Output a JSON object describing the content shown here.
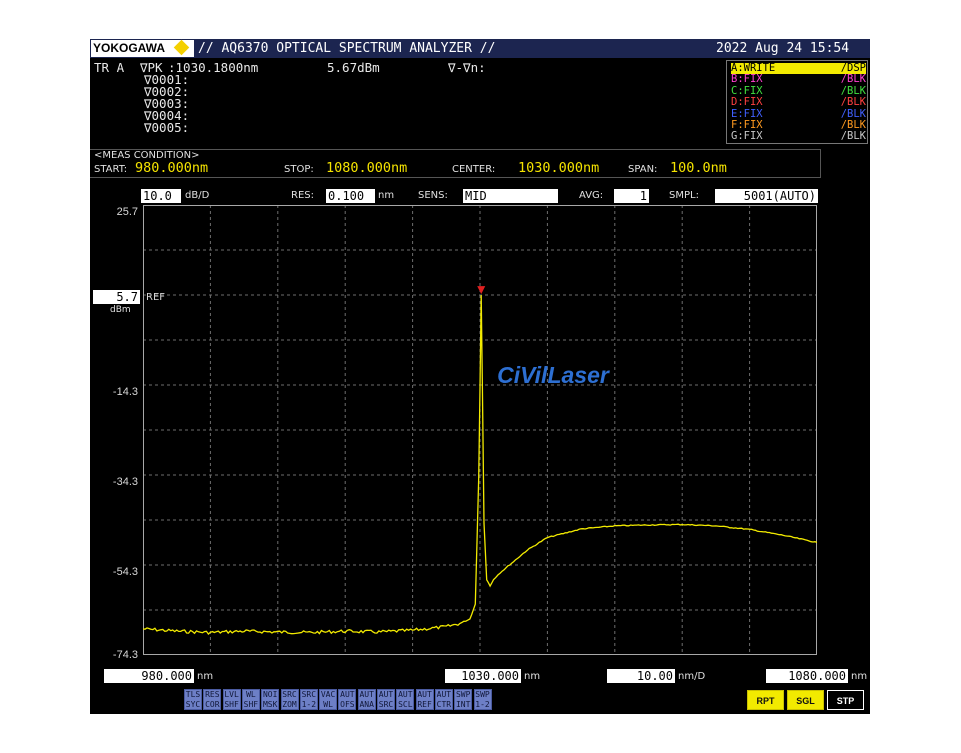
{
  "brand": "YOKOGAWA",
  "title": "// AQ6370 OPTICAL SPECTRUM ANALYZER //",
  "datetime": "2022 Aug 24 15:54",
  "trace_label": "TR A",
  "marker": {
    "peak_label": "∇PK",
    "peak_wl": ":1030.1800nm",
    "peak_level": "5.67dBm",
    "delta_label": "∇-∇n:",
    "list": [
      "∇0001:",
      "∇0002:",
      "∇0003:",
      "∇0004:",
      "∇0005:"
    ]
  },
  "traces": [
    {
      "name": "A:WRITE",
      "mode": "/DSP",
      "color": "#f2ea00",
      "highlight": true
    },
    {
      "name": "B:FIX",
      "mode": "/BLK",
      "color": "#ff40d0",
      "highlight": false
    },
    {
      "name": "C:FIX",
      "mode": "/BLK",
      "color": "#40e040",
      "highlight": false
    },
    {
      "name": "D:FIX",
      "mode": "/BLK",
      "color": "#ff4040",
      "highlight": false
    },
    {
      "name": "E:FIX",
      "mode": "/BLK",
      "color": "#4060ff",
      "highlight": false
    },
    {
      "name": "F:FIX",
      "mode": "/BLK",
      "color": "#ff9a20",
      "highlight": false
    },
    {
      "name": "G:FIX",
      "mode": "/BLK",
      "color": "#c8c8c8",
      "highlight": false
    }
  ],
  "conditions": {
    "header": "<MEAS CONDITION>",
    "start_label": "START:",
    "start": "980.000nm",
    "stop_label": "STOP:",
    "stop": "1080.000nm",
    "center_label": "CENTER:",
    "center": "1030.000nm",
    "span_label": "SPAN:",
    "span": "100.0nm"
  },
  "settings": {
    "scale": "10.0",
    "scale_unit": "dB/D",
    "res_label": "RES:",
    "res": "0.100",
    "res_unit": "nm",
    "sens_label": "SENS:",
    "sens": "MID",
    "avg_label": "AVG:",
    "avg": "1",
    "smpl_label": "SMPL:",
    "smpl": "5001(AUTO)"
  },
  "ref": {
    "value": "5.7",
    "unit": "dBm",
    "label": "REF"
  },
  "watermark": "CiVilLaser",
  "x_axis": {
    "start": "980.000",
    "center": "1030.000",
    "per_div": "10.00",
    "per_div_unit": "nm/D",
    "stop": "1080.000",
    "unit": "nm"
  },
  "softkeys": [
    {
      "l1": "TLS",
      "l2": "SYC"
    },
    {
      "l1": "RES",
      "l2": "COR"
    },
    {
      "l1": "LVL",
      "l2": "SHF"
    },
    {
      "l1": "WL",
      "l2": "SHF"
    },
    {
      "l1": "NOI",
      "l2": "MSK"
    },
    {
      "l1": "SRC",
      "l2": "ZOM"
    },
    {
      "l1": "SRC",
      "l2": "1-2"
    },
    {
      "l1": "VAC",
      "l2": "WL"
    },
    {
      "l1": "AUT",
      "l2": "OFS"
    },
    {
      "l1": "AUT",
      "l2": "ANA"
    },
    {
      "l1": "AUT",
      "l2": "SRC"
    },
    {
      "l1": "AUT",
      "l2": "SCL"
    },
    {
      "l1": "AUT",
      "l2": "REF"
    },
    {
      "l1": "AUT",
      "l2": "CTR"
    },
    {
      "l1": "SWP",
      "l2": "INT"
    },
    {
      "l1": "SWP",
      "l2": "1-2"
    }
  ],
  "sweep_buttons": [
    {
      "label": "RPT",
      "active": false
    },
    {
      "label": "SGL",
      "active": false
    },
    {
      "label": "STP",
      "active": true
    }
  ],
  "chart_data": {
    "type": "line",
    "xlim": [
      980,
      1080
    ],
    "ylim": [
      -74.3,
      25.7
    ],
    "y_ticks": [
      "25.7",
      "5.7",
      "-14.3",
      "-34.3",
      "-54.3",
      "-74.3"
    ],
    "grid": true,
    "trace_color": "#f2ea00",
    "marker_color": "#e02020",
    "peak": {
      "x": 1030.18,
      "y": 5.67
    },
    "series": [
      {
        "x": [
          980,
          985,
          990,
          995,
          1000,
          1005,
          1010,
          1015,
          1020,
          1025,
          1027,
          1028.5,
          1029.3,
          1029.8,
          1030.0,
          1030.18,
          1030.35,
          1030.6,
          1031,
          1031.5,
          1032,
          1033,
          1035,
          1037,
          1040,
          1045,
          1050,
          1055,
          1060,
          1065,
          1070,
          1075,
          1080
        ],
        "y": [
          -68.5,
          -69.0,
          -69.3,
          -69.0,
          -69.2,
          -69.3,
          -69.0,
          -69.2,
          -68.8,
          -68.0,
          -67.3,
          -66.3,
          -63.0,
          -35.0,
          -15.0,
          5.67,
          -15.0,
          -45.0,
          -57.5,
          -59.0,
          -57.5,
          -56.0,
          -53.5,
          -51.0,
          -48.2,
          -46.3,
          -45.6,
          -45.4,
          -45.3,
          -45.6,
          -46.4,
          -47.7,
          -49.3
        ]
      }
    ]
  }
}
